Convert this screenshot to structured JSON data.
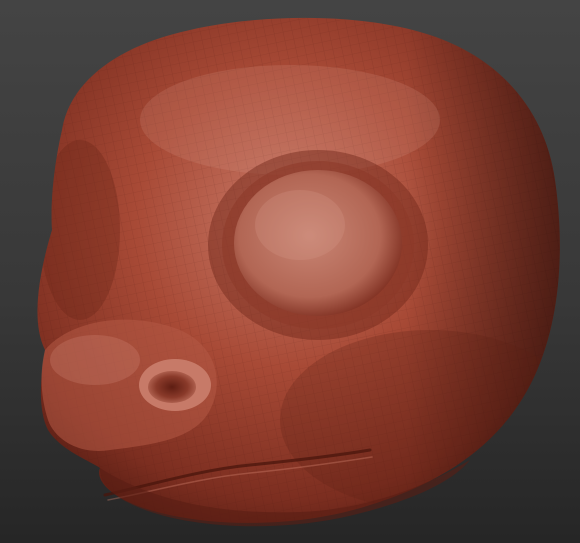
{
  "scene": {
    "subject": "sculpted-creature-head-mesh",
    "view": "three-quarter-front",
    "material_color": "#A84A36",
    "material_highlight": "#D98A75",
    "material_shadow": "#5A1E14",
    "background_top": "#444444",
    "background_bottom": "#262626",
    "wireframe": true
  }
}
